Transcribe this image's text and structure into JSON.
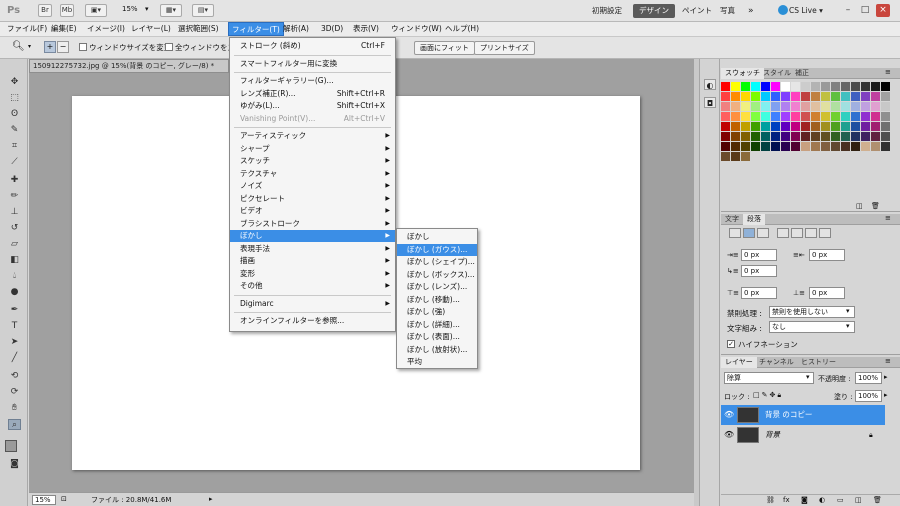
{
  "titlebar": {
    "logo": "Ps",
    "btn_br": "Br",
    "btn_mb": "Mb",
    "zoom": "15%",
    "workspaces": [
      "初期設定",
      "デザイン",
      "ペイント",
      "写真"
    ],
    "more": "»",
    "cslive": "CS Live ▾"
  },
  "menubar": {
    "items": [
      "ファイル(F)",
      "編集(E)",
      "イメージ(I)",
      "レイヤー(L)",
      "選択範囲(S)",
      "フィルター(T)",
      "解析(A)",
      "3D(D)",
      "表示(V)",
      "ウィンドウ(W)",
      "ヘルプ(H)"
    ],
    "active": "フィルター(T)"
  },
  "options": {
    "chk1": "ウィンドウサイズを変更",
    "chk2": "全ウィンドウをズー",
    "btn_fit": "画面にフィット",
    "btn_print": "プリントサイズ"
  },
  "document": {
    "tab_title": "150912275732.jpg @ 15%(背景 のコピー, グレー/8) *",
    "status_zoom": "15%",
    "status_info": "ファイル : 20.8M/41.6M"
  },
  "filter_menu": {
    "items": [
      {
        "label": "ストローク (斜め)",
        "shortcut": "Ctrl+F"
      },
      {
        "sep": true
      },
      {
        "label": "スマートフィルター用に変換"
      },
      {
        "sep": true
      },
      {
        "label": "フィルターギャラリー(G)..."
      },
      {
        "label": "レンズ補正(R)...",
        "shortcut": "Shift+Ctrl+R"
      },
      {
        "label": "ゆがみ(L)...",
        "shortcut": "Shift+Ctrl+X"
      },
      {
        "label": "Vanishing Point(V)...",
        "shortcut": "Alt+Ctrl+V",
        "disabled": true
      },
      {
        "sep": true
      },
      {
        "label": "アーティスティック",
        "sub": true
      },
      {
        "label": "シャープ",
        "sub": true
      },
      {
        "label": "スケッチ",
        "sub": true
      },
      {
        "label": "テクスチャ",
        "sub": true
      },
      {
        "label": "ノイズ",
        "sub": true
      },
      {
        "label": "ピクセレート",
        "sub": true
      },
      {
        "label": "ビデオ",
        "sub": true
      },
      {
        "label": "ブラシストローク",
        "sub": true
      },
      {
        "label": "ぼかし",
        "sub": true,
        "selected": true
      },
      {
        "label": "表現手法",
        "sub": true
      },
      {
        "label": "描画",
        "sub": true
      },
      {
        "label": "変形",
        "sub": true
      },
      {
        "label": "その他",
        "sub": true
      },
      {
        "sep": true
      },
      {
        "label": "Digimarc",
        "sub": true
      },
      {
        "sep": true
      },
      {
        "label": "オンラインフィルターを参照..."
      }
    ]
  },
  "blur_submenu": {
    "items": [
      {
        "label": "ぼかし"
      },
      {
        "label": "ぼかし (ガウス)...",
        "selected": true
      },
      {
        "label": "ぼかし (シェイプ)..."
      },
      {
        "label": "ぼかし (ボックス)..."
      },
      {
        "label": "ぼかし (レンズ)..."
      },
      {
        "label": "ぼかし (移動)..."
      },
      {
        "label": "ぼかし (強)"
      },
      {
        "label": "ぼかし (詳細)..."
      },
      {
        "label": "ぼかし (表面)..."
      },
      {
        "label": "ぼかし (放射状)..."
      },
      {
        "label": "平均"
      }
    ]
  },
  "swatches_panel": {
    "tabs": [
      "スウォッチ",
      "スタイル",
      "補正"
    ]
  },
  "paragraph_panel": {
    "tabs": [
      "文字",
      "段落"
    ],
    "indent_left": "0 px",
    "indent_right": "0 px",
    "indent_first": "0 px",
    "space_before": "0 px",
    "space_after": "0 px",
    "kinsoku_label": "禁則処理 :",
    "kinsoku_value": "禁則を使用しない",
    "mojikumi_label": "文字組み :",
    "mojikumi_value": "なし",
    "hyphenation": "ハイフネーション"
  },
  "layers_panel": {
    "tabs": [
      "レイヤー",
      "チャンネル",
      "ヒストリー"
    ],
    "blend_mode": "除算",
    "opacity_label": "不透明度 :",
    "opacity": "100%",
    "lock_label": "ロック :",
    "fill_label": "塗り :",
    "fill": "100%",
    "layers": [
      {
        "name": "背景 のコピー",
        "selected": true
      },
      {
        "name": "背景",
        "selected": false
      }
    ]
  },
  "colors": {
    "accent": "#3b8ee6",
    "swatch_rows": [
      [
        "#ff0000",
        "#ffff00",
        "#00ff00",
        "#00ffff",
        "#0000ff",
        "#ff00ff",
        "#ffffff",
        "#e6e6e6",
        "#cccccc",
        "#b3b3b3",
        "#999999",
        "#808080",
        "#666666",
        "#4d4d4d",
        "#333333",
        "#1a1a1a",
        "#000000"
      ],
      [
        "#ff4040",
        "#ff8c00",
        "#ffd700",
        "#7cfc00",
        "#00c8ff",
        "#3060ff",
        "#8040ff",
        "#ff40c0",
        "#c04040",
        "#c08040",
        "#c0c040",
        "#60c040",
        "#40c0c0",
        "#4060c0",
        "#8040c0",
        "#c040a0",
        "#a0a0a0"
      ],
      [
        "#f08080",
        "#f0b080",
        "#f0f080",
        "#a0f080",
        "#80f0f0",
        "#80a0f0",
        "#b080f0",
        "#f080d0",
        "#e0a0a0",
        "#e0c0a0",
        "#e0e0a0",
        "#b0e0a0",
        "#a0e0e0",
        "#a0b0e0",
        "#c0a0e0",
        "#e0a0d0",
        "#c8c8c8"
      ],
      [
        "#ff6060",
        "#ff9040",
        "#ffe040",
        "#80ff40",
        "#40ffe0",
        "#4080ff",
        "#a040ff",
        "#ff40a0",
        "#d05050",
        "#d08030",
        "#d0c030",
        "#70d030",
        "#30d0c0",
        "#3070d0",
        "#9030d0",
        "#d03090",
        "#909090"
      ],
      [
        "#c00000",
        "#c06000",
        "#c0a000",
        "#40a000",
        "#00a0a0",
        "#0040c0",
        "#6000c0",
        "#c00080",
        "#a02020",
        "#a06020",
        "#a09020",
        "#50a020",
        "#20a090",
        "#2050a0",
        "#7020a0",
        "#a02070",
        "#707070"
      ],
      [
        "#800000",
        "#804000",
        "#806000",
        "#206000",
        "#006060",
        "#002080",
        "#400080",
        "#800050",
        "#602020",
        "#604020",
        "#605020",
        "#306020",
        "#206050",
        "#203060",
        "#402060",
        "#602040",
        "#505050"
      ],
      [
        "#500000",
        "#502800",
        "#504000",
        "#104000",
        "#004040",
        "#001050",
        "#280050",
        "#500030",
        "#c8a080",
        "#a07850",
        "#806040",
        "#604830",
        "#483020",
        "#302010",
        "#d0b090",
        "#b09070",
        "#303030"
      ],
      [
        "#6a4a2a",
        "#5a3a1a",
        "#8a6a3a"
      ]
    ]
  }
}
